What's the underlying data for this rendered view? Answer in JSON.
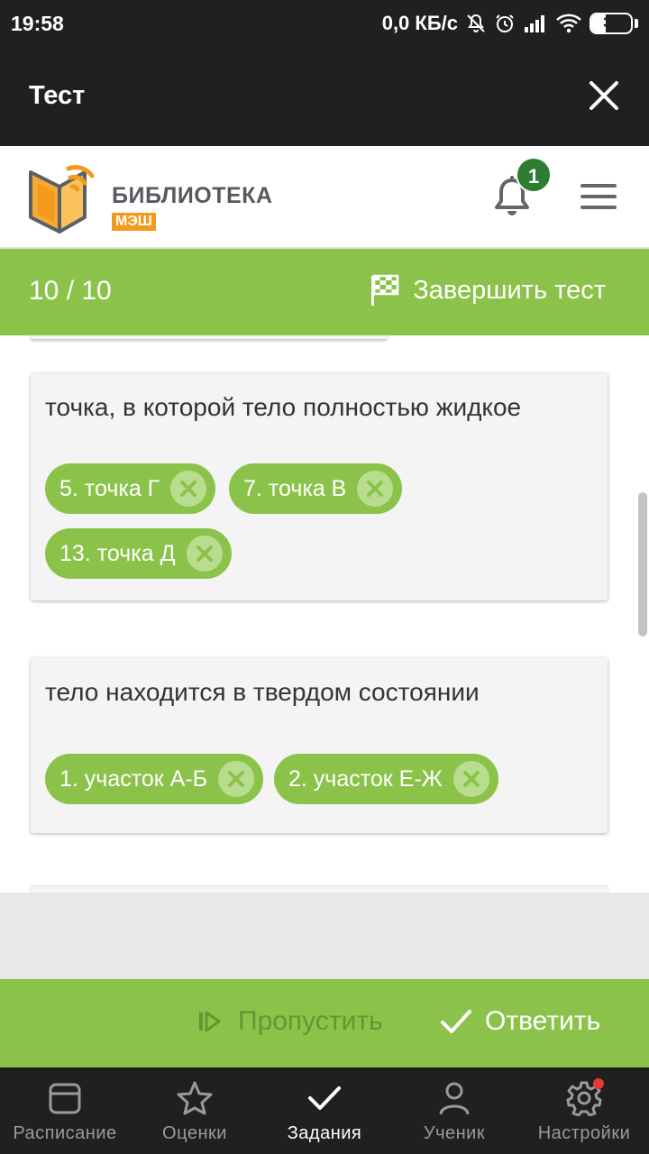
{
  "status_bar": {
    "time": "19:58",
    "network_speed": "0,0 КБ/с",
    "battery_level": "36",
    "battery_fraction": 0.36
  },
  "title_bar": {
    "title": "Тест"
  },
  "header": {
    "logo_title": "БИБЛИОТЕКА",
    "logo_subtitle": "МЭШ",
    "notification_count": "1"
  },
  "progress": {
    "counter": "10 / 10",
    "finish_label": "Завершить тест"
  },
  "cards": [
    {
      "title": "точка, в которой тело полностью жидкое",
      "chips": [
        {
          "label": "5. точка Г"
        },
        {
          "label": "7. точка В"
        },
        {
          "label": "13. точка Д"
        }
      ]
    },
    {
      "title": "тело находится в твердом состоянии",
      "chips": [
        {
          "label": "1. участок А-Б"
        },
        {
          "label": "2. участок Е-Ж"
        }
      ]
    }
  ],
  "actions": {
    "skip_label": "Пропустить",
    "answer_label": "Ответить"
  },
  "bottom_nav": {
    "items": [
      {
        "label": "Расписание",
        "icon": "calendar-icon"
      },
      {
        "label": "Оценки",
        "icon": "star-icon"
      },
      {
        "label": "Задания",
        "icon": "check-icon"
      },
      {
        "label": "Ученик",
        "icon": "user-icon"
      },
      {
        "label": "Настройки",
        "icon": "gear-icon"
      }
    ],
    "active_index": 2
  },
  "colors": {
    "accent_green": "#8bc34a",
    "dark_bar": "#202020",
    "badge_green": "#2e7d32",
    "logo_orange": "#f39a1e"
  }
}
